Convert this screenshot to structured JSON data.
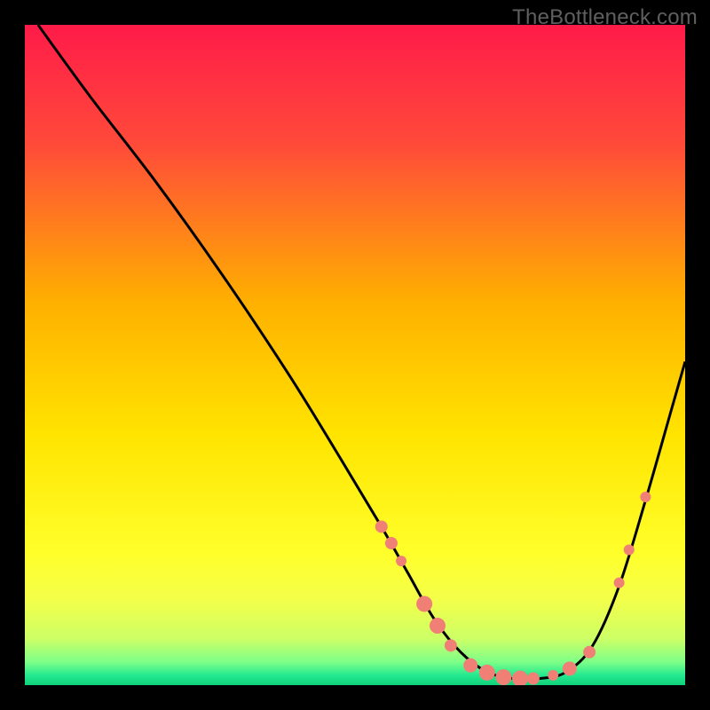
{
  "watermark": "TheBottleneck.com",
  "chart_data": {
    "type": "line",
    "title": "",
    "xlabel": "",
    "ylabel": "",
    "xlim": [
      0,
      100
    ],
    "ylim": [
      0,
      100
    ],
    "grid": false,
    "legend": false,
    "gradient_stops": [
      {
        "offset": 0.0,
        "color": "#ff1b49"
      },
      {
        "offset": 0.18,
        "color": "#ff4a3a"
      },
      {
        "offset": 0.42,
        "color": "#ffb000"
      },
      {
        "offset": 0.62,
        "color": "#ffe400"
      },
      {
        "offset": 0.8,
        "color": "#ffff2a"
      },
      {
        "offset": 0.87,
        "color": "#f4ff4a"
      },
      {
        "offset": 0.93,
        "color": "#ccff66"
      },
      {
        "offset": 0.965,
        "color": "#7dff88"
      },
      {
        "offset": 0.985,
        "color": "#24e98f"
      },
      {
        "offset": 1.0,
        "color": "#0fd17a"
      }
    ],
    "series": [
      {
        "name": "bottleneck-curve",
        "color": "#000000",
        "x": [
          2,
          10,
          20,
          30,
          40,
          48,
          54,
          58,
          62,
          66,
          70,
          74,
          78,
          82,
          86,
          90,
          94,
          98,
          100
        ],
        "y": [
          100,
          89,
          76,
          62,
          47,
          34,
          24,
          17,
          10,
          5,
          2,
          1,
          1,
          2,
          6,
          15,
          28,
          42,
          49
        ]
      }
    ],
    "markers": {
      "name": "highlight-dots",
      "color": "#f08076",
      "radius_default": 7,
      "points": [
        {
          "x": 54.0,
          "y": 24.0,
          "r": 7
        },
        {
          "x": 55.5,
          "y": 21.5,
          "r": 7
        },
        {
          "x": 57.0,
          "y": 18.8,
          "r": 6
        },
        {
          "x": 60.5,
          "y": 12.3,
          "r": 9
        },
        {
          "x": 62.5,
          "y": 9.0,
          "r": 9
        },
        {
          "x": 64.5,
          "y": 6.0,
          "r": 7
        },
        {
          "x": 67.5,
          "y": 3.0,
          "r": 8
        },
        {
          "x": 70.0,
          "y": 1.9,
          "r": 9
        },
        {
          "x": 72.5,
          "y": 1.2,
          "r": 9
        },
        {
          "x": 75.0,
          "y": 1.0,
          "r": 9
        },
        {
          "x": 77.0,
          "y": 1.0,
          "r": 7
        },
        {
          "x": 80.0,
          "y": 1.5,
          "r": 6
        },
        {
          "x": 82.5,
          "y": 2.5,
          "r": 8
        },
        {
          "x": 85.5,
          "y": 5.0,
          "r": 7
        },
        {
          "x": 90.0,
          "y": 15.5,
          "r": 6
        },
        {
          "x": 91.5,
          "y": 20.5,
          "r": 6
        },
        {
          "x": 94.0,
          "y": 28.5,
          "r": 6
        }
      ]
    }
  }
}
